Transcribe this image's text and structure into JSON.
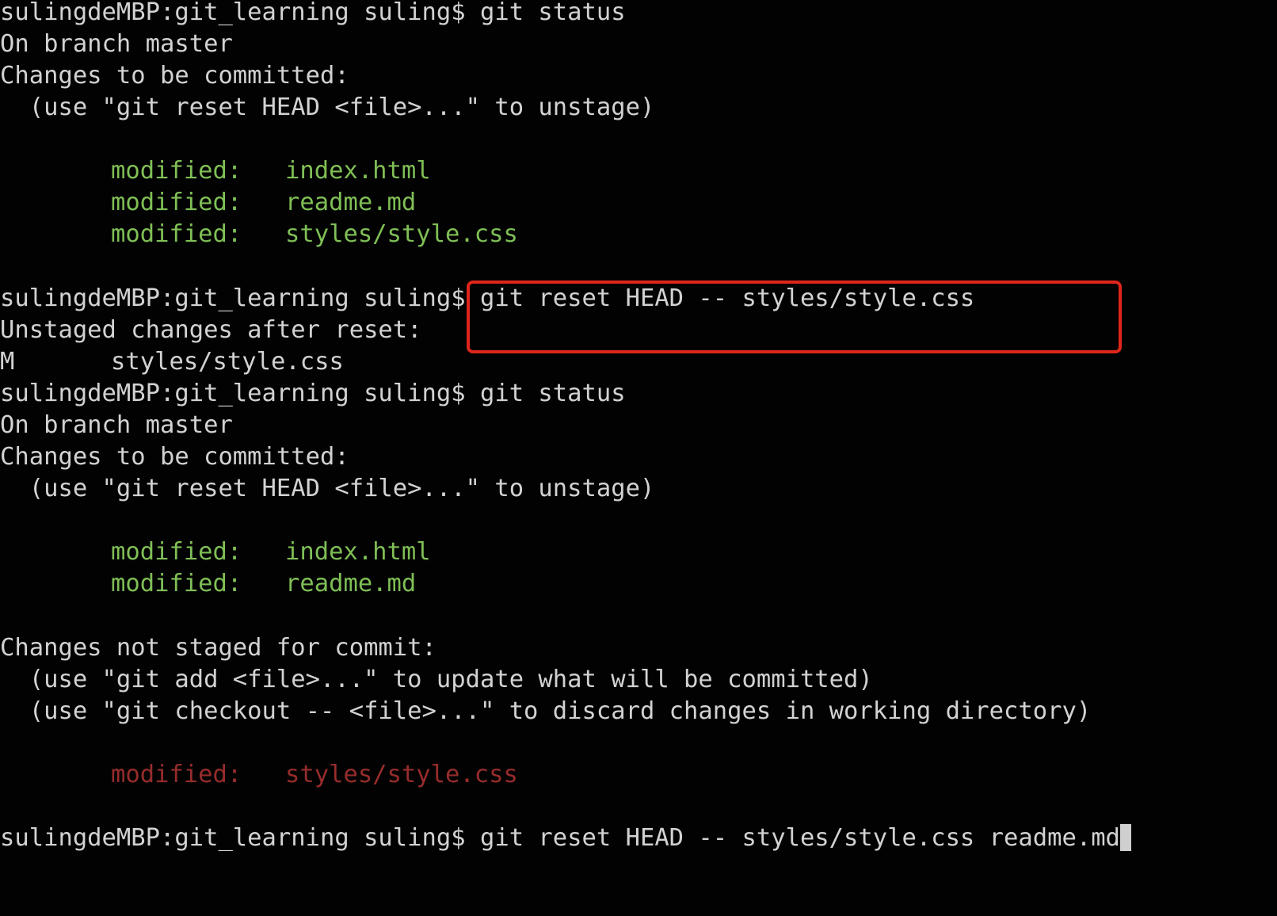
{
  "colors": {
    "background": "#020202",
    "text": "#d2d2d2",
    "staged": "#7fbf56",
    "unstaged": "#b03434",
    "highlight_box": "#e0251b"
  },
  "terminal": {
    "block1": {
      "prompt": "sulingdeMBP:git_learning suling$ ",
      "command": "git status",
      "branch_line": "On branch master",
      "changes_header": "Changes to be committed:",
      "hint": "  (use \"git reset HEAD <file>...\" to unstage)",
      "staged": [
        {
          "label": "modified:",
          "file": "index.html"
        },
        {
          "label": "modified:",
          "file": "readme.md"
        },
        {
          "label": "modified:",
          "file": "styles/style.css"
        }
      ]
    },
    "block2": {
      "prompt": "sulingdeMBP:git_learning suling$ ",
      "command": "git reset HEAD -- styles/style.css",
      "unstaged_header": "Unstaged changes after reset:",
      "result_flag": "M",
      "result_file": "styles/style.css"
    },
    "block3": {
      "prompt": "sulingdeMBP:git_learning suling$ ",
      "command": "git status",
      "branch_line": "On branch master",
      "changes_header": "Changes to be committed:",
      "hint": "  (use \"git reset HEAD <file>...\" to unstage)",
      "staged": [
        {
          "label": "modified:",
          "file": "index.html"
        },
        {
          "label": "modified:",
          "file": "readme.md"
        }
      ],
      "not_staged_header": "Changes not staged for commit:",
      "not_staged_hint1": "  (use \"git add <file>...\" to update what will be committed)",
      "not_staged_hint2": "  (use \"git checkout -- <file>...\" to discard changes in working directory)",
      "not_staged": [
        {
          "label": "modified:",
          "file": "styles/style.css"
        }
      ]
    },
    "block4": {
      "prompt": "sulingdeMBP:git_learning suling$ ",
      "command": "git reset HEAD -- styles/style.css readme.md"
    }
  }
}
